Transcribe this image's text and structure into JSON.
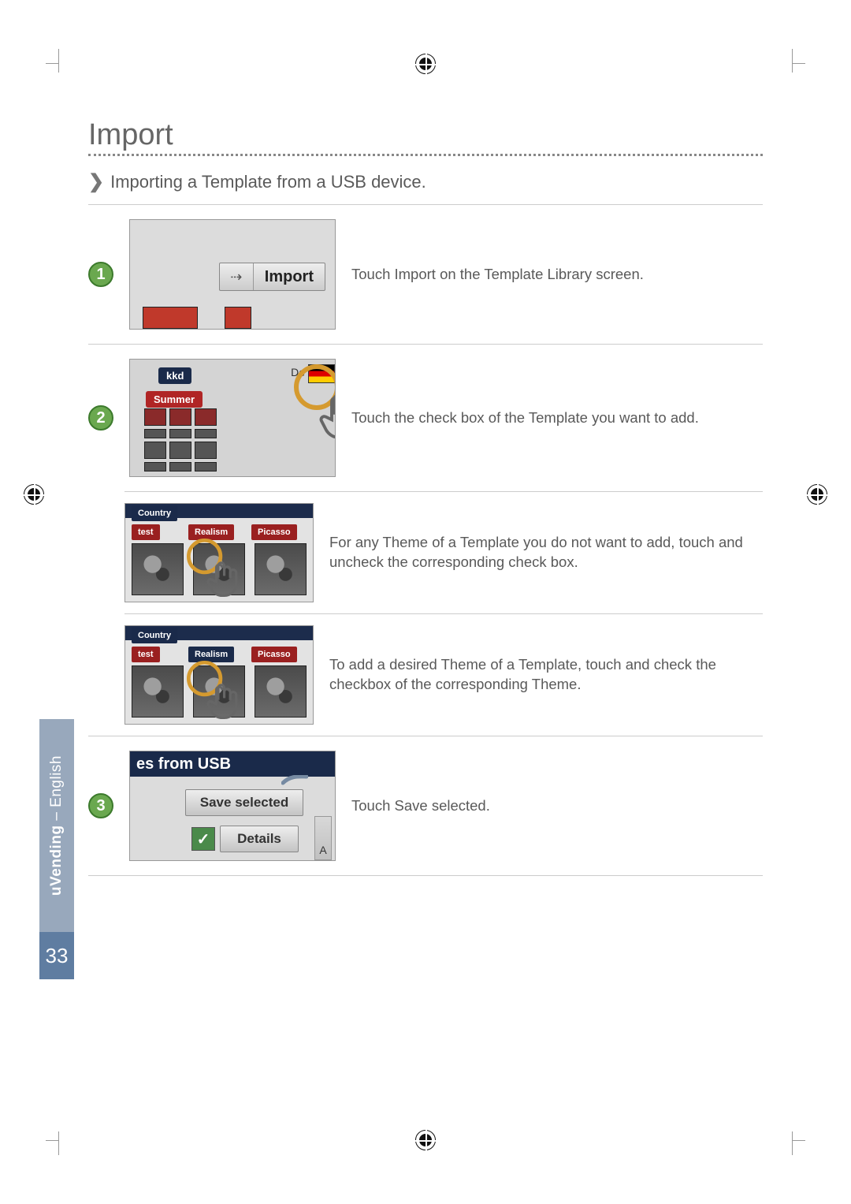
{
  "section_title": "Import",
  "subheading": "Importing a Template from a USB device.",
  "steps": {
    "s1": {
      "num": "1",
      "desc": "Touch Import on the Template Library screen.",
      "import_label": "Import"
    },
    "s2": {
      "num": "2",
      "desc": "Touch the check box of the Template you want to add.",
      "template_labels": {
        "kkd": "kkd",
        "summer": "Summer"
      },
      "country_flag_hint": "De"
    },
    "s2b": {
      "desc": "For any Theme of a Template you do not want to add, touch and uncheck the corresponding check box.",
      "themes": {
        "country": "Country",
        "test": "test",
        "realism": "Realism",
        "picasso": "Picasso"
      }
    },
    "s2c": {
      "desc": "To add a desired Theme of a Template, touch and check the checkbox of the corresponding Theme.",
      "themes": {
        "country": "Country",
        "test": "test",
        "realism": "Realism",
        "picasso": "Picasso"
      }
    },
    "s3": {
      "num": "3",
      "desc": "Touch Save selected.",
      "titlebar": "es from USB",
      "save_label": "Save selected",
      "details_label": "Details",
      "alpha_hint": "A"
    }
  },
  "side_tab": {
    "bold": "uVending",
    "sep": " – ",
    "lang": "English"
  },
  "page_number": "33"
}
